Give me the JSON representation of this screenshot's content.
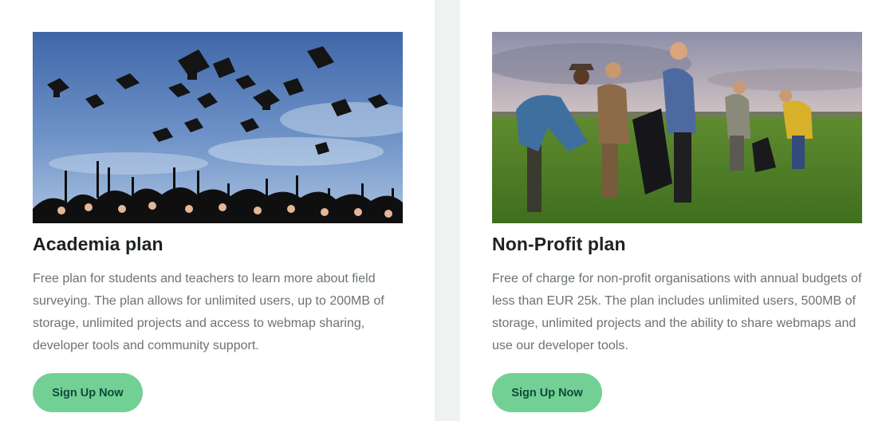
{
  "plans": [
    {
      "title": "Academia plan",
      "description": "Free plan for students and teachers to learn more about field surveying. The plan allows for unlimited users, up to 200MB of storage, unlimited projects and access to webmap sharing, developer tools and community support.",
      "cta_label": "Sign Up Now",
      "image_icon": "graduation-caps-photo"
    },
    {
      "title": "Non-Profit plan",
      "description": "Free of charge for non-profit organisations with annual budgets of less than EUR 25k. The plan includes unlimited users, 500MB of storage, unlimited projects and the ability to share webmaps and use our developer tools.",
      "cta_label": "Sign Up Now",
      "image_icon": "volunteers-litter-picking-photo"
    }
  ],
  "colors": {
    "button_bg": "#73d094",
    "button_text": "#0e4a3b",
    "title": "#1d2124",
    "body_text": "#6b7276",
    "page_bg": "#eef3f0"
  }
}
